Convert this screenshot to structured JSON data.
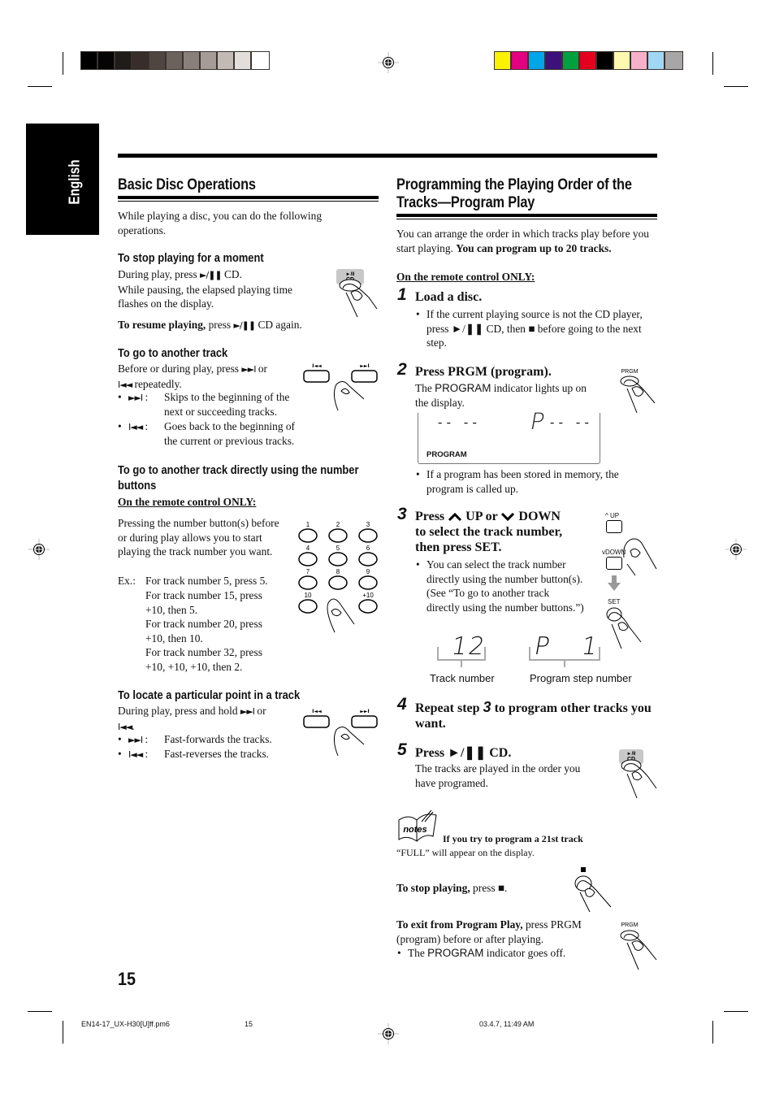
{
  "print_marks": {
    "gray_swatches": [
      "#000000",
      "#060405",
      "#201c1a",
      "#372d2b",
      "#4f4641",
      "#6b625c",
      "#8a807b",
      "#a59c97",
      "#c2bab5",
      "#e2dedb",
      "#ffffff"
    ],
    "color_swatches": [
      "#fbf200",
      "#e3007f",
      "#00a6e8",
      "#3c1179",
      "#00a03e",
      "#e3001e",
      "#000000",
      "#fff9b0",
      "#f6b1c9",
      "#9fd7f4",
      "#a7a7a7"
    ]
  },
  "sidebar_tab": {
    "label": "English"
  },
  "left": {
    "title": "Basic Disc Operations",
    "intro": "While playing a disc, you can do the following operations.",
    "stop": {
      "heading": "To stop playing for a moment",
      "line1_pre": "During play, press ",
      "play_pause_glyph": "►/❚❚",
      "line1_post": " CD.",
      "line2": "While pausing, the elapsed playing time flashes on the display.",
      "resume_bold": "To resume playing,",
      "resume_rest_pre": " press ",
      "resume_rest_post": " CD again.",
      "button_label": "►/II CD"
    },
    "another": {
      "heading": "To go to another track",
      "line_pre": "Before or during play, press ",
      "next_glyph": "►►I",
      "mid": " or",
      "prev_glyph": "I◄◄",
      "line_post": " repeatedly.",
      "bullets": [
        {
          "glyph": "►►I",
          "text": "Skips to the beginning of the next or succeeding tracks."
        },
        {
          "glyph": "I◄◄",
          "text": "Goes back to the beginning of the current or previous tracks."
        }
      ],
      "btn_prev_label": "I◄◄",
      "btn_next_label": "►►I"
    },
    "direct": {
      "heading_line1": "To go to another track directly using the number",
      "heading_line2": "buttons",
      "remote_only": "On the remote control ONLY:",
      "body": "Pressing the number button(s) before or during play allows you to start playing the track number you want.",
      "ex_label": "Ex.:",
      "examples": [
        "For track number 5, press 5.",
        "For track number 15, press +10, then 5.",
        "For track number 20, press +10, then 10.",
        "For track number 32, press +10, +10, +10, then 2."
      ],
      "keypad": [
        "1",
        "2",
        "3",
        "4",
        "5",
        "6",
        "7",
        "8",
        "9",
        "10",
        "",
        "+10"
      ]
    },
    "locate": {
      "heading": "To locate a particular point in a track",
      "line_pre": "During play, press and hold ",
      "mid": " or",
      "bullets": [
        {
          "glyph": "►►I",
          "text": "Fast-forwards the tracks."
        },
        {
          "glyph": "I◄◄",
          "text": "Fast-reverses the tracks."
        }
      ]
    }
  },
  "right": {
    "title_line1": "Programming the Playing Order of the",
    "title_line2": "Tracks—Program Play",
    "intro_normal": "You can arrange the order in which tracks play before you start playing. ",
    "intro_bold": "You can program up to 20 tracks.",
    "remote_only": "On the remote control ONLY:",
    "steps": [
      {
        "num": "1",
        "title": "Load a disc.",
        "bullet": "If the current playing source is not the CD player, press ►/❚❚ CD, then ■ before going to the next step."
      },
      {
        "num": "2",
        "title": "Press PRGM (program).",
        "body_pre": "The ",
        "body_indicator": "PROGRAM",
        "body_post": " indicator lights up on the display.",
        "lcd_left": "-- --",
        "lcd_right_p": "P",
        "lcd_right": "-- --",
        "lcd_indicator": "PROGRAM",
        "bullet": "If a program has been stored in memory, the program is called up.",
        "button_label": "PRGM"
      },
      {
        "num": "3",
        "title_line1": "Press ⌃ UP or ⌄ DOWN",
        "title_parts": [
          "Press ",
          " UP or ",
          " DOWN"
        ],
        "title_line2": "to select the track number,",
        "title_line3": "then press SET.",
        "bullet": "You can select the track number directly using the number button(s). (See “To go to another track directly using the number buttons.”)",
        "lcd_track": "12",
        "lcd_step_p": "P",
        "lcd_step": "1",
        "label_track": "Track number",
        "label_step": "Program step number",
        "btn_up": "UP",
        "btn_down": "DOWN",
        "btn_set": "SET"
      },
      {
        "num": "4",
        "title_pre": "Repeat step ",
        "title_ref": "3",
        "title_post": " to program other tracks you want."
      },
      {
        "num": "5",
        "title": "Press ►/❚❚ CD.",
        "body": "The tracks are played in the order you have programed.",
        "button_label": "►/II CD"
      }
    ],
    "notes": {
      "icon_label": "notes",
      "heading": "If you try to program a 21st track",
      "text": "“FULL” will appear on the display."
    },
    "stop_bold": "To stop playing,",
    "stop_rest": " press ■.",
    "exit_bold": "To exit from Program Play,",
    "exit_rest": " press PRGM (program) before or after playing.",
    "exit_bullet_pre": "The ",
    "exit_bullet_ind": "PROGRAM",
    "exit_bullet_post": " indicator goes off.",
    "stop_btn_glyph": "■",
    "exit_btn_label": "PRGM"
  },
  "page_number": "15",
  "footer": {
    "file": "EN14-17_UX-H30[U]ff.pm6",
    "page": "15",
    "timestamp": "03.4.7, 11:49 AM"
  }
}
